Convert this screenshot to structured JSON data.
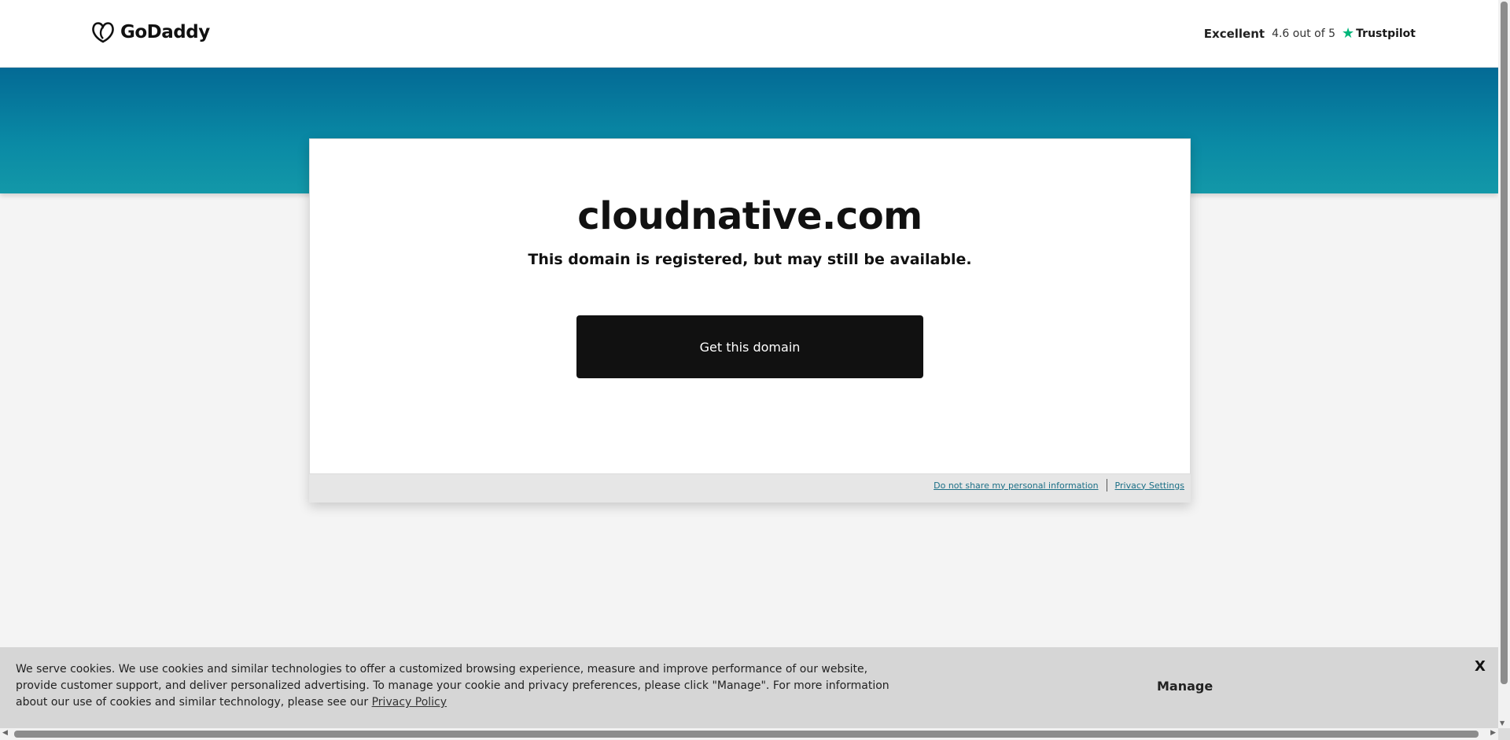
{
  "header": {
    "brand": "GoDaddy",
    "trust": {
      "label": "Excellent",
      "rating": "4.6 out of 5",
      "provider": "Trustpilot",
      "star_icon": "star-icon",
      "star_color": "#00b67a"
    }
  },
  "main": {
    "domain": "cloudnative.com",
    "subtitle": "This domain is registered, but may still be available.",
    "cta_label": "Get this domain"
  },
  "footer_links": {
    "do_not_share": "Do not share my personal information",
    "privacy_settings": "Privacy Settings"
  },
  "cookie_banner": {
    "text": "We serve cookies. We use cookies and similar technologies to offer a customized browsing experience, measure and improve performance of our website, provide customer support, and deliver personalized advertising. To manage your cookie and privacy preferences, please click \"Manage\". For more information about our use of cookies and similar technology, please see our ",
    "policy_link": "Privacy Policy",
    "manage_label": "Manage",
    "close_label": "X"
  },
  "colors": {
    "band_top": "#036a95",
    "band_bottom": "#1398a8",
    "cta_bg": "#111111",
    "link": "#1b6f86"
  }
}
